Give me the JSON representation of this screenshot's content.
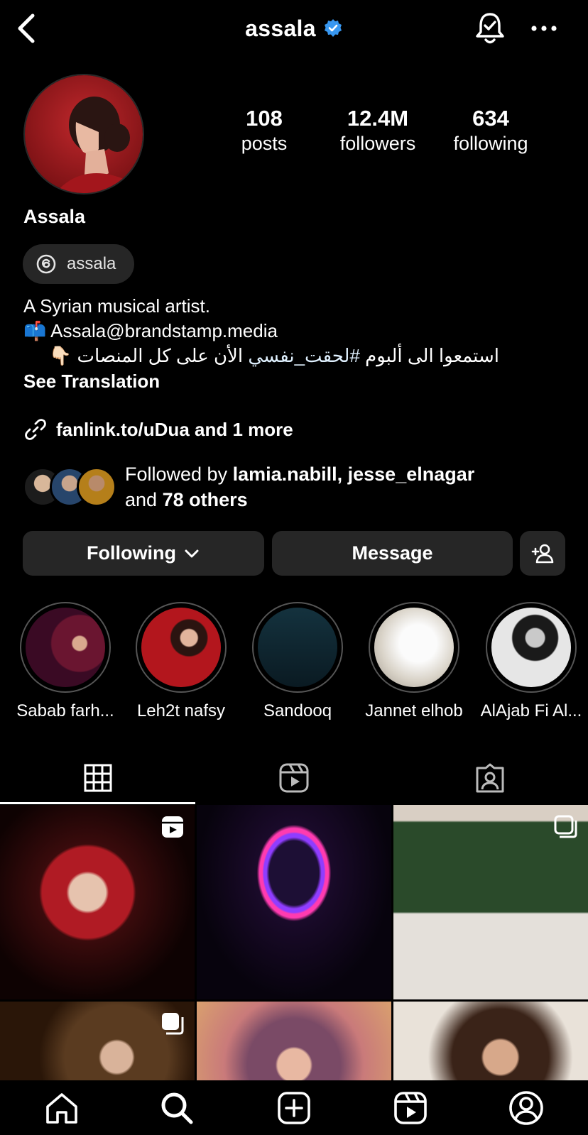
{
  "header": {
    "username": "assala",
    "verified": true
  },
  "profile": {
    "display_name": "Assala",
    "threads_handle": "assala",
    "stats": [
      {
        "value": "108",
        "label": "posts"
      },
      {
        "value": "12.4M",
        "label": "followers"
      },
      {
        "value": "634",
        "label": "following"
      }
    ],
    "bio": {
      "line1": "A Syrian musical artist.",
      "line2_emoji": "📫",
      "line2": "Assala@brandstamp.media",
      "line3_emoji": "👇🏻",
      "line3_before": "استمعوا الى ألبوم ",
      "line3_hashtag": "#لحقت_نفسي",
      "line3_after": " الأن على كل المنصات",
      "see_translation": "See Translation"
    },
    "link": "fanlink.to/uDua and 1 more",
    "followed_by": {
      "prefix": "Followed by ",
      "names": "lamia.nabill, jesse_elnagar",
      "and": "and ",
      "others": "78 others"
    }
  },
  "actions": {
    "following_label": "Following",
    "message_label": "Message"
  },
  "highlights": [
    {
      "label": "Sabab farh..."
    },
    {
      "label": "Leh2t nafsy"
    },
    {
      "label": "Sandooq"
    },
    {
      "label": "Jannet elhob"
    },
    {
      "label": "AlAjab Fi Al..."
    }
  ],
  "tabs": [
    "grid-icon",
    "reels-icon",
    "tagged-icon"
  ],
  "bottom_nav": [
    "home-icon",
    "search-icon",
    "create-icon",
    "reels-icon",
    "profile-icon"
  ],
  "colors": {
    "background": "#000000",
    "button_bg": "#262626",
    "verified_blue": "#3897f0"
  }
}
